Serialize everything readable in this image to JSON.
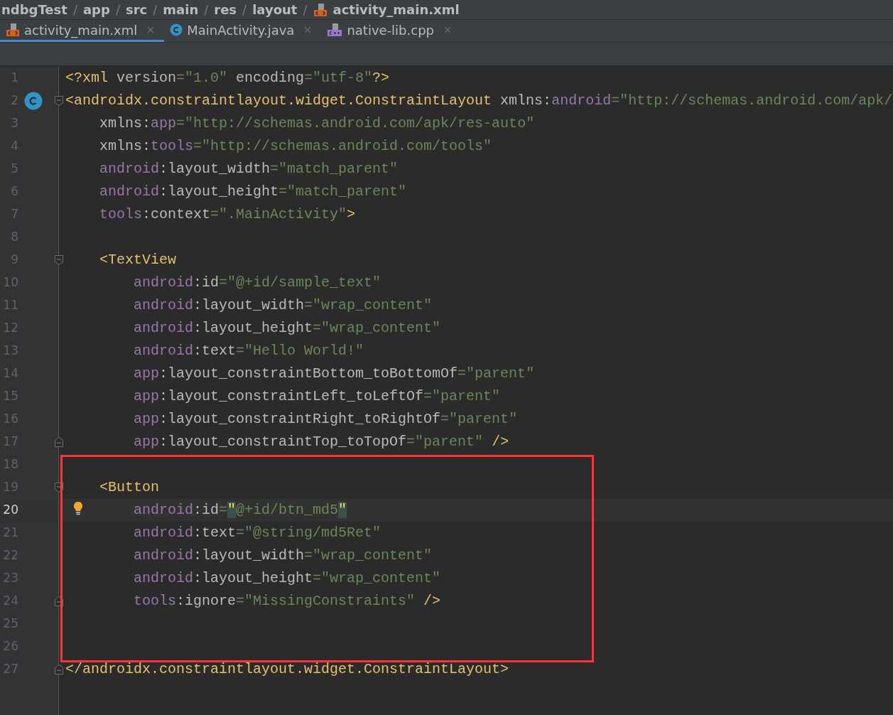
{
  "breadcrumb": {
    "separator": "/",
    "items": [
      {
        "label": "ndbgTest",
        "kind": "folder"
      },
      {
        "label": "app",
        "kind": "folder"
      },
      {
        "label": "src",
        "kind": "folder"
      },
      {
        "label": "main",
        "kind": "folder"
      },
      {
        "label": "res",
        "kind": "folder"
      },
      {
        "label": "layout",
        "kind": "folder"
      },
      {
        "label": "activity_main.xml",
        "kind": "xml"
      }
    ]
  },
  "tabs": [
    {
      "label": "activity_main.xml",
      "kind": "xml",
      "selected": true
    },
    {
      "label": "MainActivity.java",
      "kind": "class",
      "selected": false
    },
    {
      "label": "native-lib.cpp",
      "kind": "cpp",
      "selected": false
    }
  ],
  "editor": {
    "blocks": [
      {
        "boxed": false,
        "lines": [
          {
            "number": "1",
            "current": false,
            "segments": [
              {
                "kind": "tag",
                "text": "<?xml"
              },
              {
                "kind": "plain",
                "text": " version"
              },
              {
                "kind": "string",
                "text": "=\"1.0\""
              },
              {
                "kind": "plain",
                "text": " encoding"
              },
              {
                "kind": "string",
                "text": "=\"utf-8\""
              },
              {
                "kind": "tag",
                "text": "?>"
              }
            ]
          },
          {
            "number": "2",
            "current": false,
            "fold": {
              "kind": "start"
            },
            "gutter": {
              "kind": "class"
            },
            "segments": [
              {
                "kind": "tag",
                "text": "<androidx.constraintlayout.widget.ConstraintLayout"
              },
              {
                "kind": "plain",
                "text": " xmlns:"
              },
              {
                "kind": "ns",
                "text": "android"
              },
              {
                "kind": "string",
                "text": "=\"http://schemas.android.com/apk/"
              }
            ]
          },
          {
            "number": "3",
            "current": false,
            "segments": [
              {
                "kind": "plain",
                "text": "    xmlns:"
              },
              {
                "kind": "ns",
                "text": "app"
              },
              {
                "kind": "string",
                "text": "=\"http://schemas.android.com/apk/res-auto\""
              }
            ]
          },
          {
            "number": "4",
            "current": false,
            "segments": [
              {
                "kind": "plain",
                "text": "    xmlns:"
              },
              {
                "kind": "ns",
                "text": "tools"
              },
              {
                "kind": "string",
                "text": "=\"http://schemas.android.com/tools\""
              }
            ]
          },
          {
            "number": "5",
            "current": false,
            "segments": [
              {
                "kind": "ns",
                "text": "    android"
              },
              {
                "kind": "plain",
                "text": ":layout_width"
              },
              {
                "kind": "string",
                "text": "=\"match_parent\""
              }
            ]
          },
          {
            "number": "6",
            "current": false,
            "segments": [
              {
                "kind": "ns",
                "text": "    android"
              },
              {
                "kind": "plain",
                "text": ":layout_height"
              },
              {
                "kind": "string",
                "text": "=\"match_parent\""
              }
            ]
          },
          {
            "number": "7",
            "current": false,
            "segments": [
              {
                "kind": "ns",
                "text": "    tools"
              },
              {
                "kind": "plain",
                "text": ":context"
              },
              {
                "kind": "string",
                "text": "=\".MainActivity\""
              },
              {
                "kind": "tag",
                "text": ">"
              }
            ]
          },
          {
            "number": "8",
            "current": false
          },
          {
            "number": "9",
            "current": false,
            "fold": {
              "kind": "start"
            },
            "segments": [
              {
                "kind": "tag",
                "text": "    <TextView"
              }
            ]
          },
          {
            "number": "10",
            "current": false,
            "segments": [
              {
                "kind": "ns",
                "text": "        android"
              },
              {
                "kind": "plain",
                "text": ":id"
              },
              {
                "kind": "string",
                "text": "=\"@+id/sample_text\""
              }
            ]
          },
          {
            "number": "11",
            "current": false,
            "segments": [
              {
                "kind": "ns",
                "text": "        android"
              },
              {
                "kind": "plain",
                "text": ":layout_width"
              },
              {
                "kind": "string",
                "text": "=\"wrap_content\""
              }
            ]
          },
          {
            "number": "12",
            "current": false,
            "segments": [
              {
                "kind": "ns",
                "text": "        android"
              },
              {
                "kind": "plain",
                "text": ":layout_height"
              },
              {
                "kind": "string",
                "text": "=\"wrap_content\""
              }
            ]
          },
          {
            "number": "13",
            "current": false,
            "segments": [
              {
                "kind": "ns",
                "text": "        android"
              },
              {
                "kind": "plain",
                "text": ":text"
              },
              {
                "kind": "string",
                "text": "=\"Hello World!\""
              }
            ]
          },
          {
            "number": "14",
            "current": false,
            "segments": [
              {
                "kind": "ns",
                "text": "        app"
              },
              {
                "kind": "plain",
                "text": ":layout_constraintBottom_toBottomOf"
              },
              {
                "kind": "string",
                "text": "=\"parent\""
              }
            ]
          },
          {
            "number": "15",
            "current": false,
            "segments": [
              {
                "kind": "ns",
                "text": "        app"
              },
              {
                "kind": "plain",
                "text": ":layout_constraintLeft_toLeftOf"
              },
              {
                "kind": "string",
                "text": "=\"parent\""
              }
            ]
          },
          {
            "number": "16",
            "current": false,
            "segments": [
              {
                "kind": "ns",
                "text": "        app"
              },
              {
                "kind": "plain",
                "text": ":layout_constraintRight_toRightOf"
              },
              {
                "kind": "string",
                "text": "=\"parent\""
              }
            ]
          },
          {
            "number": "17",
            "current": false,
            "fold": {
              "kind": "end"
            },
            "segments": [
              {
                "kind": "ns",
                "text": "        app"
              },
              {
                "kind": "plain",
                "text": ":layout_constraintTop_toTopOf"
              },
              {
                "kind": "string",
                "text": "=\"parent\""
              },
              {
                "kind": "tag",
                "text": " />"
              }
            ]
          }
        ]
      },
      {
        "boxed": true,
        "lines": [
          {
            "number": "18",
            "current": false
          },
          {
            "number": "19",
            "current": false,
            "fold": {
              "kind": "start"
            },
            "segments": [
              {
                "kind": "tag",
                "text": "    <Button"
              }
            ]
          },
          {
            "number": "20",
            "current": true,
            "gutter": {
              "kind": "bulb"
            },
            "segments": [
              {
                "kind": "ns",
                "text": "        android"
              },
              {
                "kind": "plain",
                "text": ":id"
              },
              {
                "kind": "string",
                "text": "="
              },
              {
                "kind": "match",
                "text": "\""
              },
              {
                "kind": "string",
                "text": "@+id/btn_md5"
              },
              {
                "kind": "match",
                "text": "\""
              }
            ]
          },
          {
            "number": "21",
            "current": false,
            "segments": [
              {
                "kind": "ns",
                "text": "        android"
              },
              {
                "kind": "plain",
                "text": ":text"
              },
              {
                "kind": "string",
                "text": "=\"@string/md5Ret\""
              }
            ]
          },
          {
            "number": "22",
            "current": false,
            "segments": [
              {
                "kind": "ns",
                "text": "        android"
              },
              {
                "kind": "plain",
                "text": ":layout_width"
              },
              {
                "kind": "string",
                "text": "=\"wrap_content\""
              }
            ]
          },
          {
            "number": "23",
            "current": false,
            "segments": [
              {
                "kind": "ns",
                "text": "        android"
              },
              {
                "kind": "plain",
                "text": ":layout_height"
              },
              {
                "kind": "string",
                "text": "=\"wrap_content\""
              }
            ]
          },
          {
            "number": "24",
            "current": false,
            "fold": {
              "kind": "end"
            },
            "segments": [
              {
                "kind": "ns",
                "text": "        tools"
              },
              {
                "kind": "plain",
                "text": ":ignore"
              },
              {
                "kind": "string",
                "text": "=\"MissingConstraints\""
              },
              {
                "kind": "tag",
                "text": " />"
              }
            ]
          },
          {
            "number": "25",
            "current": false
          },
          {
            "number": "26",
            "current": false
          }
        ]
      },
      {
        "boxed": false,
        "lines": [
          {
            "number": "27",
            "current": false,
            "fold": {
              "kind": "end"
            },
            "segments": [
              {
                "kind": "tag",
                "text": "</androidx.constraintlayout.widget.ConstraintLayout>"
              }
            ]
          }
        ]
      }
    ]
  }
}
